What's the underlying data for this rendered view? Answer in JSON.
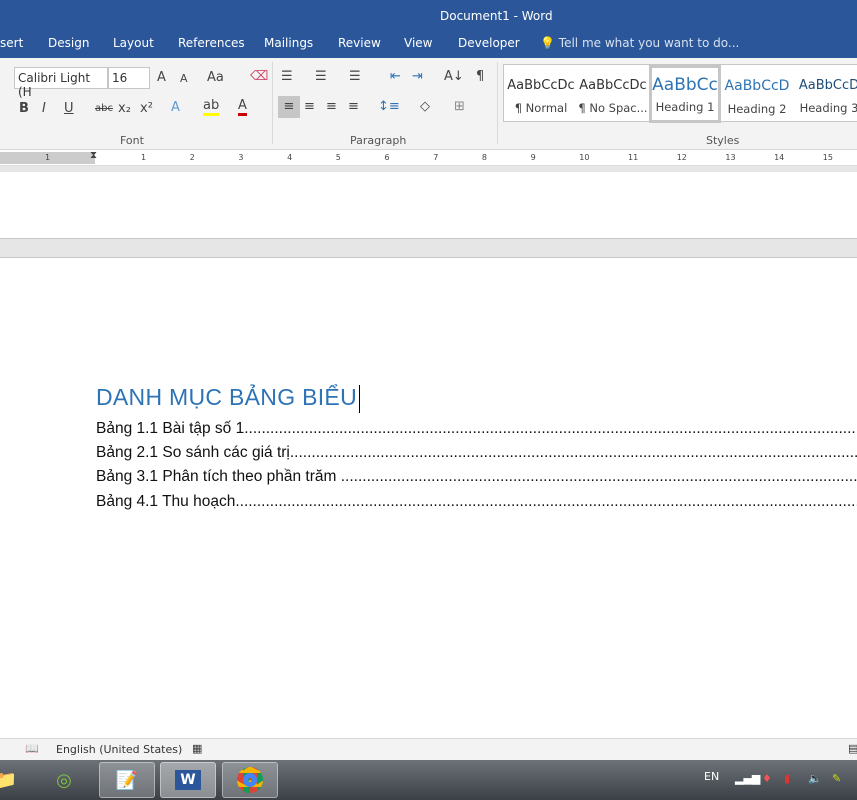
{
  "title_bar": {
    "title": "Document1 - Word"
  },
  "tabs": [
    "sert",
    "Design",
    "Layout",
    "References",
    "Mailings",
    "Review",
    "View",
    "Developer"
  ],
  "tell_me": "Tell me what you want to do...",
  "font_group": {
    "font_name": "Calibri Light (H",
    "font_size": "16",
    "label": "Font",
    "bold": "B",
    "italic": "I",
    "underline": "U",
    "strike": "abc",
    "sub": "x₂",
    "sup": "x²",
    "grow": "A",
    "shrink": "A",
    "case": "Aa"
  },
  "paragraph_group": {
    "label": "Paragraph"
  },
  "styles_group": {
    "label": "Styles",
    "items": [
      {
        "preview": "AaBbCcDc",
        "name": "¶ Normal",
        "color": "#000000"
      },
      {
        "preview": "AaBbCcDc",
        "name": "¶ No Spac...",
        "color": "#000000"
      },
      {
        "preview": "AaBbCc",
        "name": "Heading 1",
        "color": "#2e74b5",
        "selected": true
      },
      {
        "preview": "AaBbCcD",
        "name": "Heading 2",
        "color": "#2e74b5"
      },
      {
        "preview": "AaBbCcD",
        "name": "Heading 3",
        "color": "#1f4d78"
      }
    ]
  },
  "ruler": {
    "left": [
      "1"
    ],
    "numbers": [
      "1",
      "2",
      "3",
      "4",
      "5",
      "6",
      "7",
      "8",
      "9",
      "10",
      "11",
      "12",
      "13",
      "14",
      "15"
    ]
  },
  "document": {
    "heading": "DANH MỤC BẢNG BIỂU",
    "entries": [
      "Bảng 1.1 Bài tập số 1",
      "Bảng 2.1 So sánh các giá trị",
      "Bảng 3.1  Phân tích theo phần trăm ",
      "Bảng 4.1 Thu hoạch"
    ],
    "leader": "........................................................................................................................................................"
  },
  "status_bar": {
    "language": "English (United States)"
  },
  "taskbar": {
    "lang": "EN",
    "apps": [
      "file-explorer",
      "coc-coc",
      "notepad-plus-plus",
      "word",
      "chrome"
    ]
  },
  "colors": {
    "brand": "#2b579a",
    "heading": "#2e74b5"
  }
}
